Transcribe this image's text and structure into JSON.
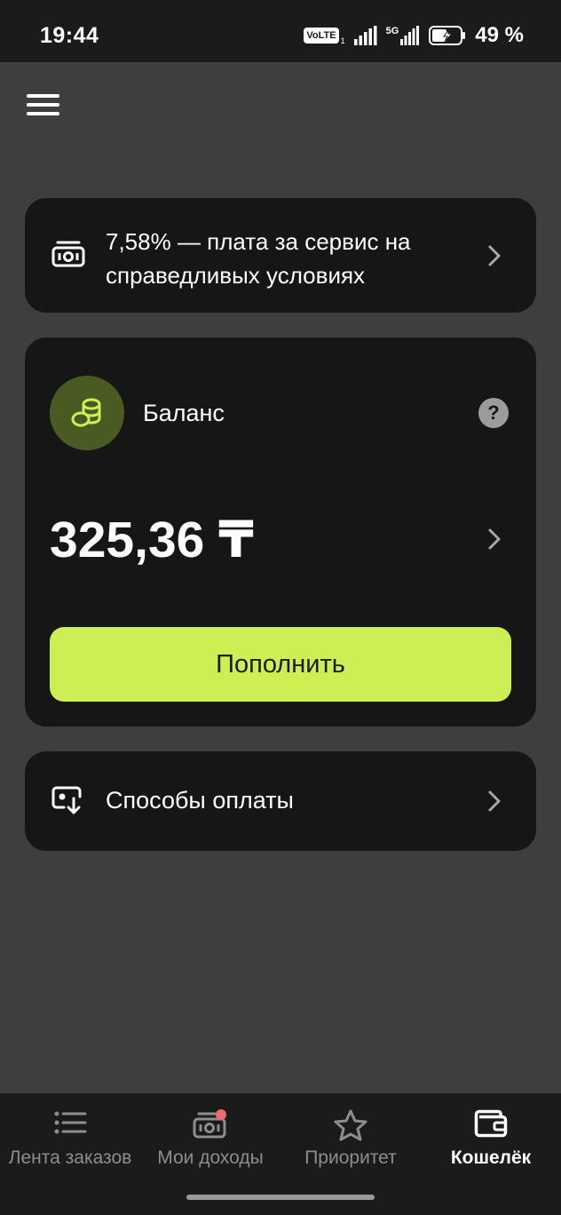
{
  "status_bar": {
    "time": "19:44",
    "volte": "VoLTE",
    "sim": "1",
    "network": "5G",
    "battery": "49 %"
  },
  "fee_card": {
    "text": "7,58% — плата за сервис на справедливых условиях",
    "icon": "banknote-icon"
  },
  "balance": {
    "label": "Баланс",
    "amount": "325,36 ₸",
    "help": "?",
    "topup_label": "Пополнить",
    "accent": "#cdef53",
    "avatar_bg": "#4a5a23",
    "icon": "coins-icon"
  },
  "payment_methods": {
    "label": "Способы оплаты",
    "icon": "payment-card-icon"
  },
  "bottom_nav": {
    "items": [
      {
        "label": "Лента заказов",
        "icon": "list-icon",
        "active": false
      },
      {
        "label": "Мои доходы",
        "icon": "income-icon",
        "active": false,
        "badge": true
      },
      {
        "label": "Приоритет",
        "icon": "star-icon",
        "active": false
      },
      {
        "label": "Кошелёк",
        "icon": "wallet-icon",
        "active": true
      }
    ]
  }
}
